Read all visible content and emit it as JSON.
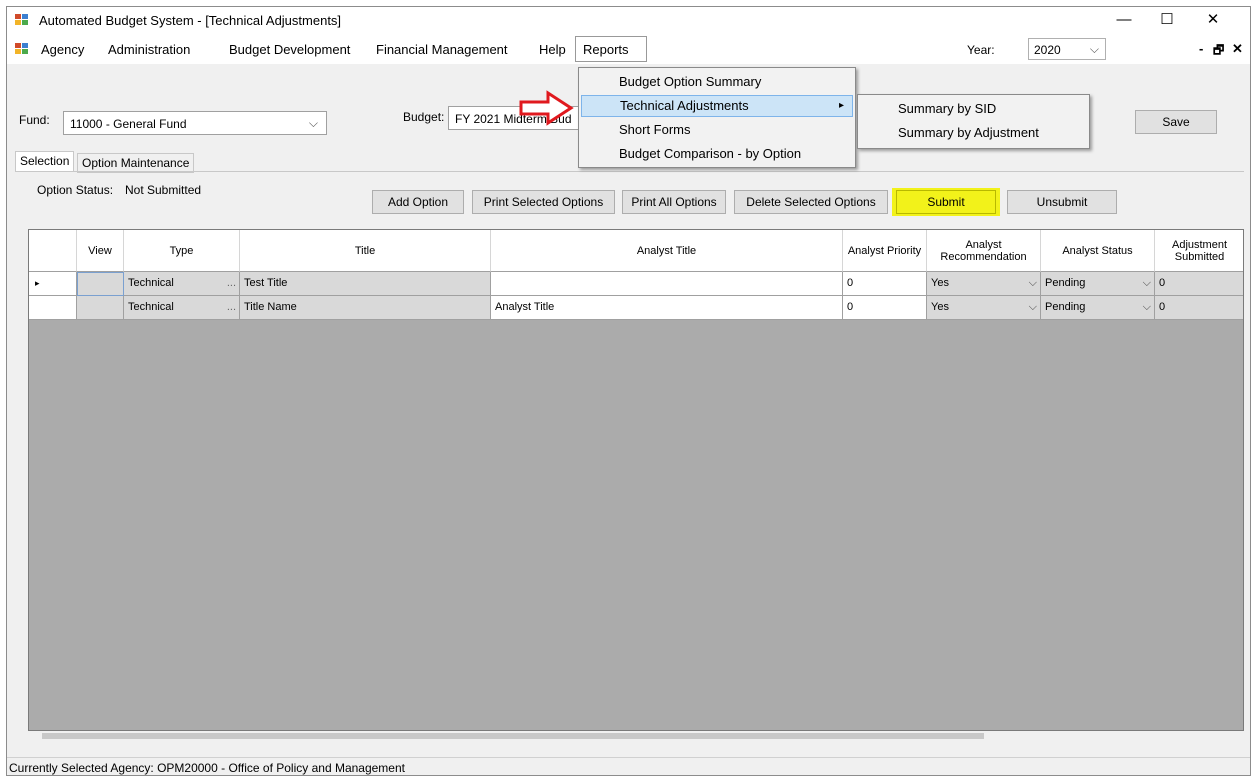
{
  "window": {
    "title": "Automated Budget System - [Technical Adjustments]",
    "controls": {
      "minimize": "—",
      "maximize": "☐",
      "close": "✕"
    }
  },
  "menubar": {
    "items": [
      "Agency",
      "Administration",
      "Budget Development",
      "Financial Management",
      "Help",
      "Reports"
    ],
    "year_label": "Year:",
    "year_value": "2020",
    "mdi_minimize": "-",
    "mdi_restore": "🗗",
    "mdi_close": "✕"
  },
  "form": {
    "fund_label": "Fund:",
    "fund_value": "11000 - General Fund",
    "budget_label": "Budget:",
    "budget_value": "FY 2021 Midterm Bud",
    "save_label": "Save",
    "tabs": [
      "Selection",
      "Option Maintenance"
    ],
    "option_status_label": "Option Status:",
    "option_status_value": "Not Submitted",
    "buttons": {
      "add_option": "Add Option",
      "print_selected": "Print Selected Options",
      "print_all": "Print All Options",
      "delete_selected": "Delete Selected Options",
      "submit": "Submit",
      "unsubmit": "Unsubmit"
    },
    "highlight_color": "#f2f21a"
  },
  "grid": {
    "columns": [
      "View",
      "Type",
      "Title",
      "Analyst Title",
      "Analyst Priority",
      "Analyst Recommendation",
      "Analyst Status",
      "Adjustment Submitted"
    ],
    "rows": [
      {
        "type": "Technical",
        "title": "Test Title",
        "analyst_title": "",
        "priority": "0",
        "recommendation": "Yes",
        "status": "Pending",
        "submitted": "0",
        "current": true
      },
      {
        "type": "Technical",
        "title": "Title Name",
        "analyst_title": "Analyst Title",
        "priority": "0",
        "recommendation": "Yes",
        "status": "Pending",
        "submitted": "0",
        "current": false
      }
    ],
    "ellipsis": "...",
    "row_indicator": "▸"
  },
  "reports_menu": {
    "items": [
      "Budget Option Summary",
      "Technical Adjustments",
      "Short Forms",
      "Budget Comparison - by Option"
    ],
    "highlighted": "Technical Adjustments",
    "submenu_arrow": "▸",
    "submenu": [
      "Summary by SID",
      "Summary by Adjustment"
    ]
  },
  "annotation": {
    "arrow_color": "#e0191e"
  },
  "status_bar": {
    "text": "Currently Selected Agency: OPM20000 - Office of Policy and Management"
  }
}
